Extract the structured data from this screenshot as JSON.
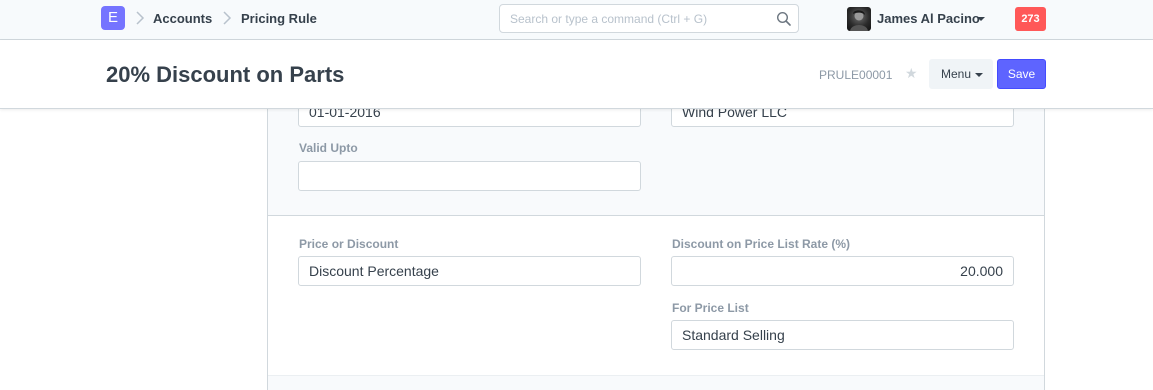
{
  "navbar": {
    "logo_letter": "E",
    "breadcrumbs": [
      "Accounts",
      "Pricing Rule"
    ],
    "search_placeholder": "Search or type a command (Ctrl + G)",
    "search_icon": "search-icon",
    "user_name": "James Al Pacino",
    "notification_count": "273"
  },
  "page_head": {
    "title": "20% Discount on Parts",
    "doc_name": "PRULE00001",
    "star_glyph": "★",
    "menu_label": "Menu",
    "save_label": "Save"
  },
  "form": {
    "valid_from_value": "01-01-2016",
    "partner_value": "Wind Power LLC",
    "valid_upto_label": "Valid Upto",
    "valid_upto_value": "",
    "price_or_discount_label": "Price or Discount",
    "price_or_discount_value": "Discount Percentage",
    "discount_rate_label": "Discount on Price List Rate (%)",
    "discount_rate_value": "20.000",
    "for_price_list_label": "For Price List",
    "for_price_list_value": "Standard Selling"
  },
  "colors": {
    "accent": "#5e64ff",
    "logo": "#7574ff",
    "badge": "#ff5858"
  }
}
